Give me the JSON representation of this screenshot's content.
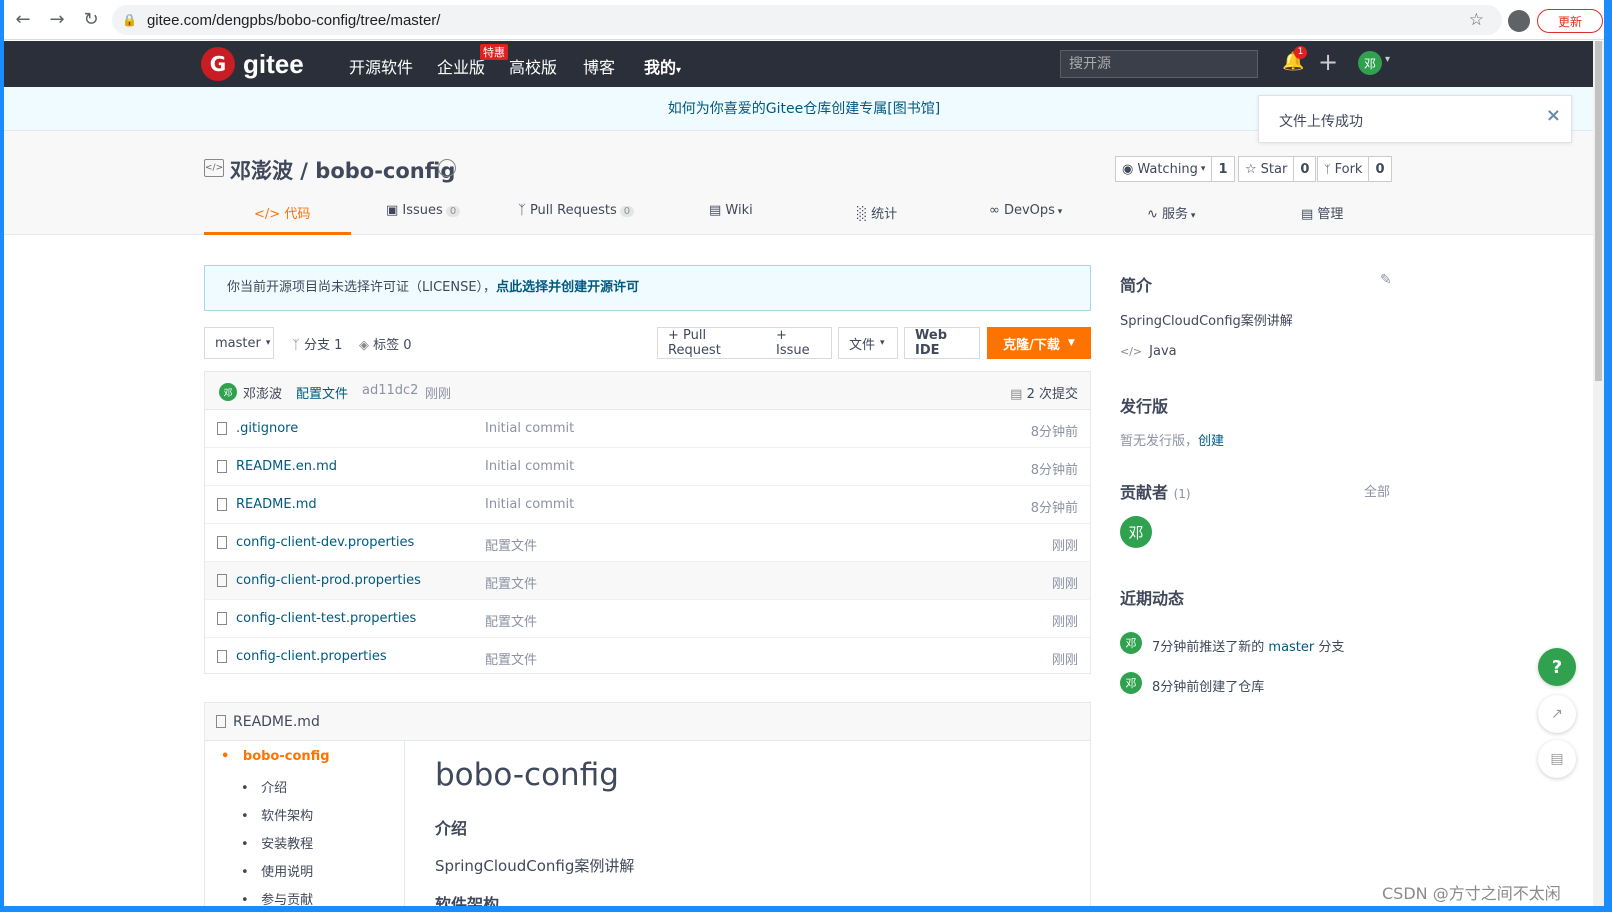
{
  "browser": {
    "url": "gitee.com/dengpbs/bobo-config/tree/master/",
    "update_label": "更新"
  },
  "header": {
    "logo_text": "gitee",
    "logo_mark": "G",
    "nav": [
      "开源软件",
      "企业版",
      "高校版",
      "博客",
      "我的"
    ],
    "hot_badge": "特惠",
    "search_placeholder": "搜开源",
    "notify_count": "1",
    "avatar_char": "邓"
  },
  "announcement": "如何为你喜爱的Gitee仓库创建专属[图书馆]",
  "toast": {
    "message": "文件上传成功"
  },
  "repo": {
    "title": "邓澎波 / bobo-config",
    "watching_label": "Watching",
    "watching_count": "1",
    "star_label": "Star",
    "star_count": "0",
    "fork_label": "Fork",
    "fork_count": "0",
    "tabs": [
      {
        "label": "代码"
      },
      {
        "label": "Issues",
        "count": "0"
      },
      {
        "label": "Pull Requests",
        "count": "0"
      },
      {
        "label": "Wiki"
      },
      {
        "label": "统计"
      },
      {
        "label": "DevOps"
      },
      {
        "label": "服务"
      },
      {
        "label": "管理"
      }
    ]
  },
  "license": {
    "text": "你当前开源项目尚未选择许可证（LICENSE），",
    "link": "点此选择并创建开源许可"
  },
  "toolbar": {
    "branch": "master",
    "branches": "分支 1",
    "tags": "标签 0",
    "pull_request": "+ Pull Request",
    "issue": "+ Issue",
    "file": "文件",
    "web_ide": "Web IDE",
    "clone": "克隆/下载"
  },
  "commit": {
    "avatar": "邓",
    "author": "邓澎波",
    "message": "配置文件",
    "hash": "ad11dc2",
    "time": "刚刚",
    "count": "2 次提交"
  },
  "files": [
    {
      "name": ".gitignore",
      "commit": "Initial commit",
      "time": "8分钟前"
    },
    {
      "name": "README.en.md",
      "commit": "Initial commit",
      "time": "8分钟前"
    },
    {
      "name": "README.md",
      "commit": "Initial commit",
      "time": "8分钟前"
    },
    {
      "name": "config-client-dev.properties",
      "commit": "配置文件",
      "time": "刚刚"
    },
    {
      "name": "config-client-prod.properties",
      "commit": "配置文件",
      "time": "刚刚"
    },
    {
      "name": "config-client-test.properties",
      "commit": "配置文件",
      "time": "刚刚"
    },
    {
      "name": "config-client.properties",
      "commit": "配置文件",
      "time": "刚刚"
    }
  ],
  "readme": {
    "header": "README.md",
    "toc": [
      "bobo-config",
      "介绍",
      "软件架构",
      "安装教程",
      "使用说明",
      "参与贡献"
    ],
    "h1": "bobo-config",
    "h2": "介绍",
    "p": "SpringCloudConfig案例讲解",
    "next_heading": "软件架构"
  },
  "sidebar": {
    "intro_title": "简介",
    "intro_text": "SpringCloudConfig案例讲解",
    "language": "Java",
    "release_title": "发行版",
    "release_text": "暂无发行版，",
    "release_link": "创建",
    "contrib_title": "贡献者",
    "contrib_count": "(1)",
    "contrib_all": "全部",
    "contrib_avatar": "邓",
    "activity_title": "近期动态",
    "activities": [
      {
        "avatar": "邓",
        "pre": "7分钟前推送了新的 ",
        "link": "master",
        "post": " 分支"
      },
      {
        "avatar": "邓",
        "pre": "8分钟前创建了仓库",
        "link": "",
        "post": ""
      }
    ]
  },
  "floating": {
    "help": "?"
  },
  "watermark": "CSDN @方寸之间不太闲",
  "colors": {
    "accent": "#fe7300",
    "link": "#005980",
    "header_bg": "#2b2f3a",
    "avatar": "#30a14e"
  }
}
